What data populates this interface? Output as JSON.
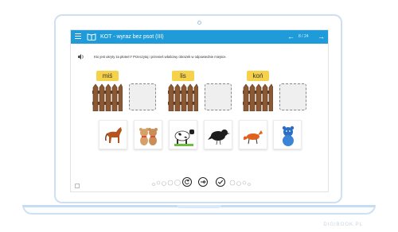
{
  "app": {
    "title": "KOT - wyraz bez psot (III)",
    "page": "8 / 24",
    "back_icon": "arrow-left-icon",
    "next_icon": "arrow-right-icon"
  },
  "exercise": {
    "instruction": "Kto jest ukryty za płotem? Przeczytaj i przenieś właściwy obrazek w odpowiednie miejsce.",
    "words": [
      "miś",
      "lis",
      "koń"
    ]
  },
  "tiles": [
    "horse",
    "teddy-bears",
    "cow",
    "crow",
    "fox",
    "blue-teddy-bear"
  ],
  "controls": [
    "reset-icon",
    "hint-icon",
    "check-icon"
  ],
  "watermark": "DIGIBOOK.PL",
  "colors": {
    "titlebar": "#1e9bd8",
    "label": "#f6d24b",
    "fence": "#7a4a2a"
  }
}
